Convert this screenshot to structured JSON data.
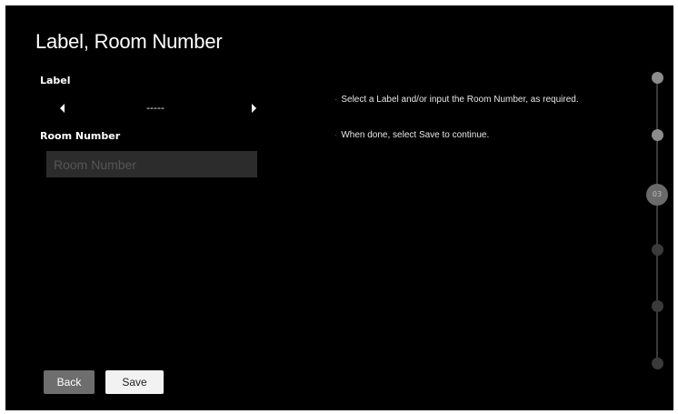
{
  "page": {
    "title": "Label, Room Number"
  },
  "label_field": {
    "heading": "Label",
    "value": "-----"
  },
  "room_field": {
    "heading": "Room Number",
    "placeholder": "Room Number",
    "value": ""
  },
  "help": [
    {
      "bullet": "·",
      "text": "Select a Label and/or input the Room Number, as required."
    },
    {
      "bullet": "·",
      "text": "When done, select Save to continue."
    }
  ],
  "buttons": {
    "back_label": "Back",
    "save_label": "Save"
  },
  "stepper": {
    "current_step": 3,
    "total_steps": 6,
    "current_label": "03"
  },
  "colors": {
    "background": "#000000",
    "input_bg": "#2c2c2c",
    "back_button": "#6e6e6e",
    "save_button": "#f2f2f2",
    "step_done": "#8c8c8c",
    "step_pending": "#3a3a3a"
  },
  "icons": {
    "prev": "triangle-left-icon",
    "next": "triangle-right-icon"
  }
}
